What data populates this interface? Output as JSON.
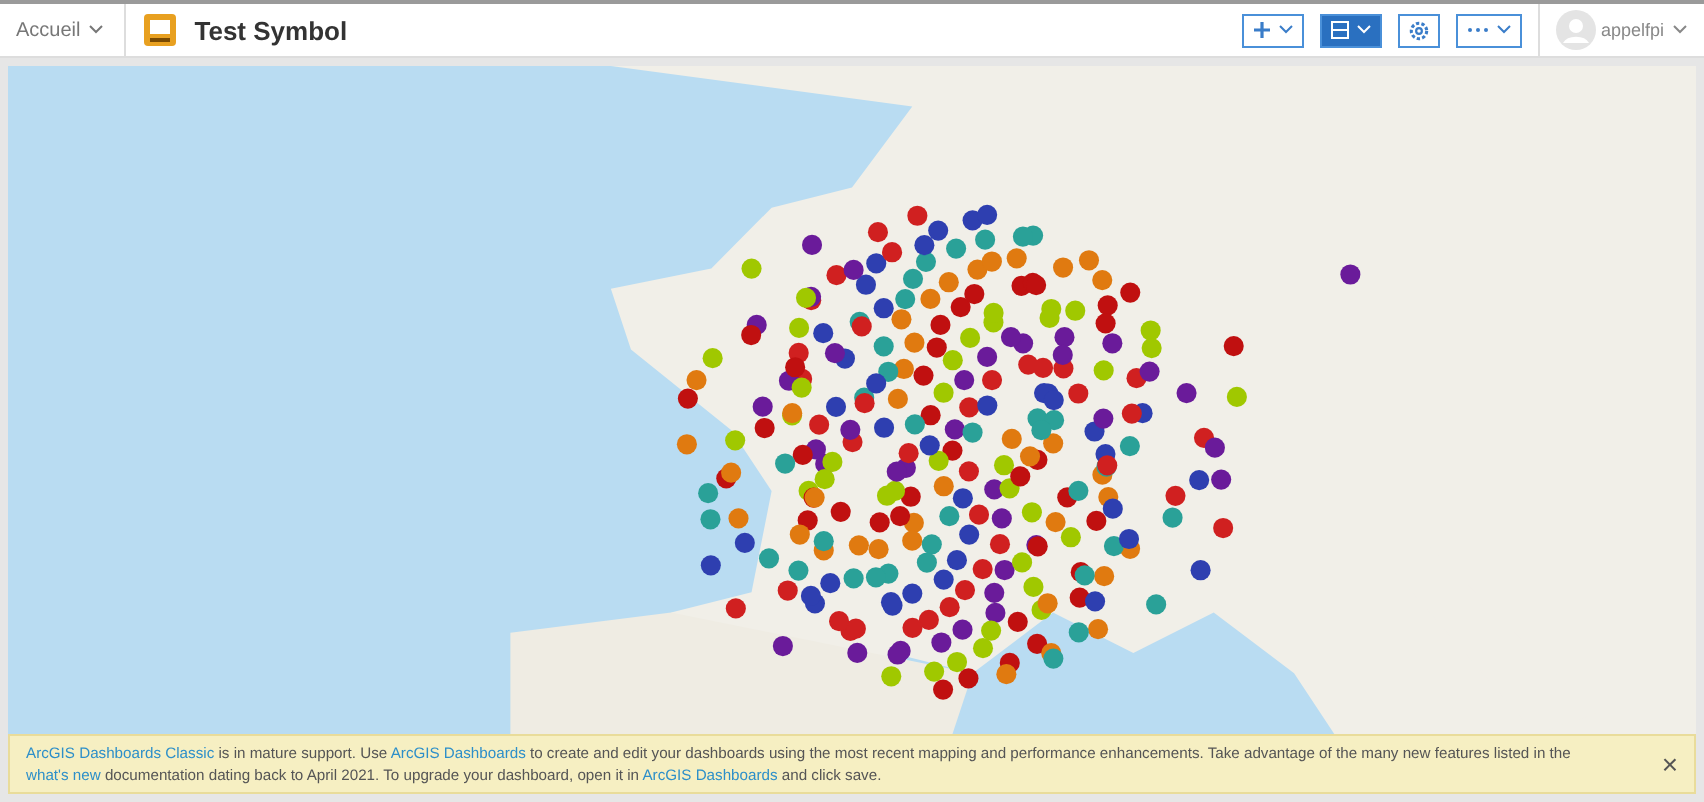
{
  "header": {
    "home_menu": "Accueil",
    "title": "Test Symbol",
    "user": "appelfpi"
  },
  "toolbar": [
    {
      "kind": "add",
      "selected": false
    },
    {
      "kind": "layout",
      "selected": true
    },
    {
      "kind": "settings",
      "selected": false
    },
    {
      "kind": "more",
      "selected": false
    }
  ],
  "banner": {
    "segments": [
      {
        "text": "ArcGIS Dashboards Classic",
        "link": true
      },
      {
        "text": " is in mature support. Use ",
        "link": false
      },
      {
        "text": "ArcGIS Dashboards",
        "link": true
      },
      {
        "text": " to create and edit your dashboards using the most recent mapping and performance enhancements. Take advantage of the many new features listed in the ",
        "link": false
      },
      {
        "text": "what's new",
        "link": true
      },
      {
        "text": " documentation dating back to April 2021. To upgrade your dashboard, open it in ",
        "link": false
      },
      {
        "text": "ArcGIS Dashboards",
        "link": true
      },
      {
        "text": " and click save.",
        "link": false
      }
    ],
    "close": "×"
  }
}
